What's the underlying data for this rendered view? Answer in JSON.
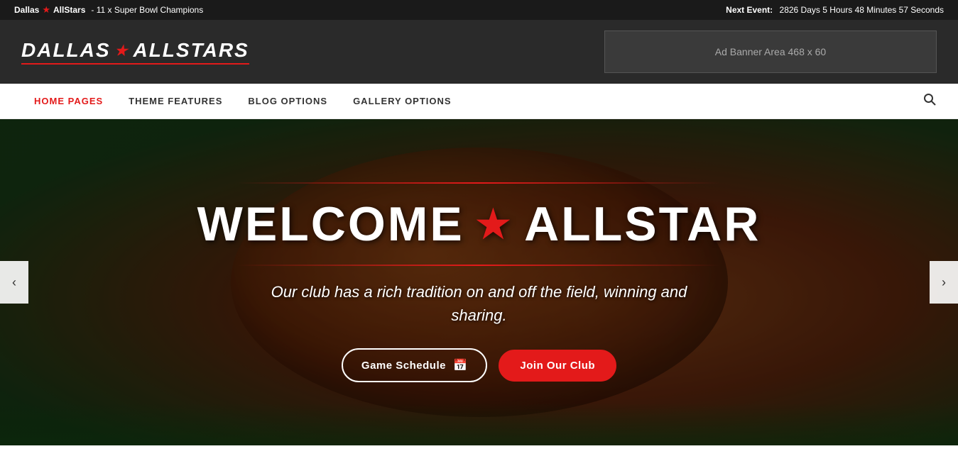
{
  "topbar": {
    "left_text": "Dallas",
    "brand": "AllStars",
    "tagline": "- 11 x Super Bowl Champions",
    "next_event_label": "Next Event:",
    "countdown": "2826 Days 5 Hours 48 Minutes 57 Seconds"
  },
  "header": {
    "logo_part1": "DALLAS",
    "logo_part2": "ALLSTARS",
    "ad_banner_text": "Ad Banner Area 468 x 60"
  },
  "nav": {
    "items": [
      {
        "label": "HOME PAGES",
        "active": true
      },
      {
        "label": "THEME FEATURES",
        "active": false
      },
      {
        "label": "BLOG OPTIONS",
        "active": false
      },
      {
        "label": "GALLERY OPTIONS",
        "active": false
      }
    ]
  },
  "hero": {
    "title_part1": "WELCOME",
    "title_part2": "ALLSTAR",
    "subtitle": "Our club has a rich tradition on and off the field, winning and sharing.",
    "btn_schedule": "Game Schedule",
    "btn_join": "Join Our Club"
  },
  "slider": {
    "arrow_left": "‹",
    "arrow_right": "›"
  }
}
